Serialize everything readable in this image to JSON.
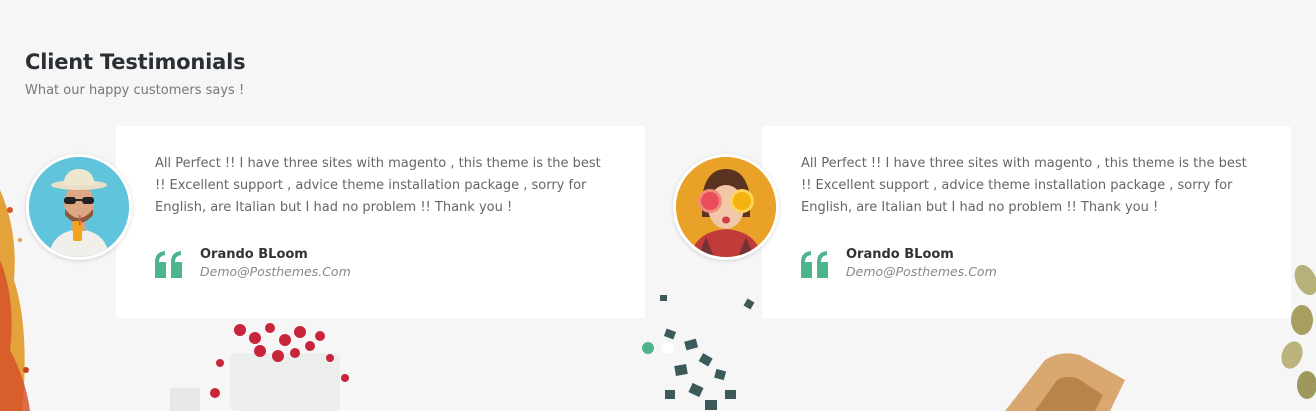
{
  "section": {
    "title": "Client Testimonials",
    "subtitle": "What our happy customers says !"
  },
  "testimonials": [
    {
      "text": "All Perfect !! I have three sites with magento , this theme is the best !! Excellent support , advice theme installation package , sorry for English, are Italian but I had no problem !! Thank you !",
      "name": "Orando BLoom",
      "email": "Demo@Posthemes.Com"
    },
    {
      "text": "All Perfect !! I have three sites with magento , this theme is the best !! Excellent support , advice theme installation package , sorry for English, are Italian but I had no problem !! Thank you !",
      "name": "Orando BLoom",
      "email": "Demo@Posthemes.Com"
    }
  ],
  "pagination": {
    "active_index": 0,
    "count": 2
  },
  "colors": {
    "accent": "#4db58b",
    "background": "#f6f6f6",
    "card": "#ffffff"
  },
  "icons": {
    "quote": "quote-icon"
  }
}
